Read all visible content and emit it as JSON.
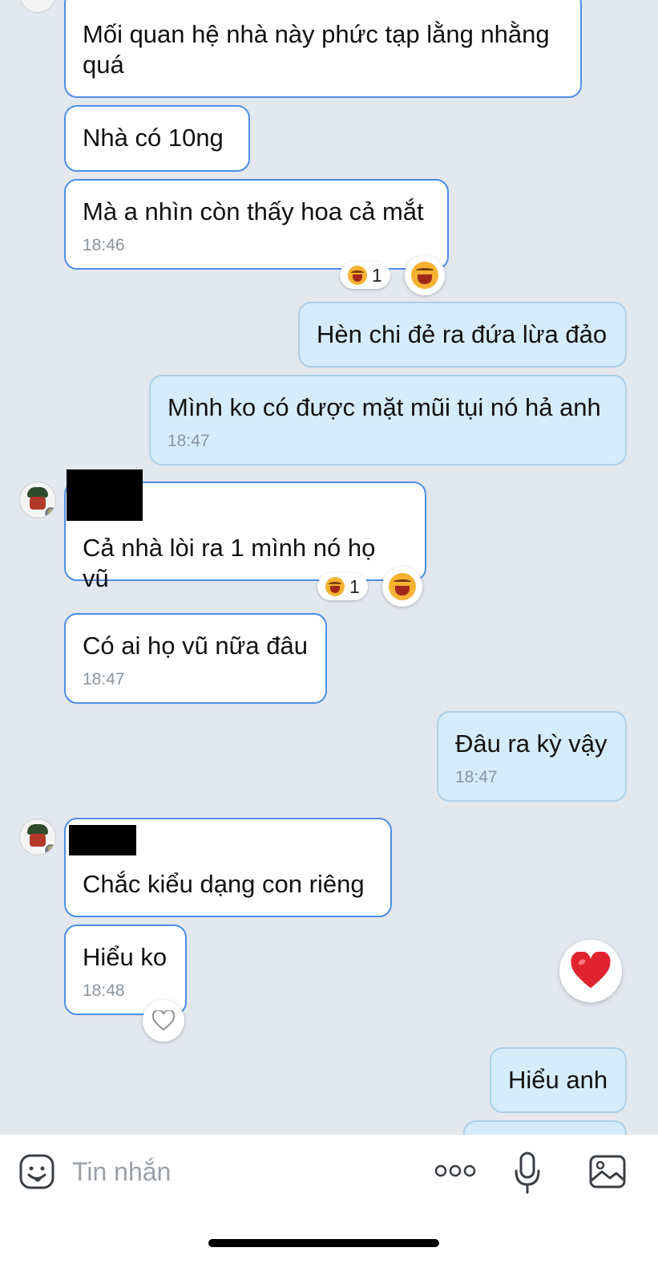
{
  "messages": [
    {
      "text": "Mối quan hệ nhà này phức tạp lằng nhằng quá",
      "time": ""
    },
    {
      "text": "Nhà có 10ng",
      "time": ""
    },
    {
      "text": "Mà a nhìn còn thấy hoa cả mắt",
      "time": "18:46",
      "reaction_count": "1"
    },
    {
      "text": "Hèn chi đẻ ra đứa lừa đảo",
      "time": ""
    },
    {
      "text": "Mình ko có được mặt mũi tụi nó hả anh",
      "time": "18:47"
    },
    {
      "text": "Cả nhà lòi ra 1 mình nó họ vũ",
      "time": "",
      "reaction_count": "1"
    },
    {
      "text": "Có ai họ vũ nữa đâu",
      "time": "18:47"
    },
    {
      "text": "Đâu ra kỳ vậy",
      "time": "18:47"
    },
    {
      "text": "Chắc kiểu dạng con riêng",
      "time": ""
    },
    {
      "text": "Hiểu ko",
      "time": "18:48"
    },
    {
      "text": "Hiểu anh",
      "time": ""
    }
  ],
  "composer": {
    "placeholder": "Tin nhắn"
  },
  "icons": {
    "sticker": "sticker-icon",
    "more": "more-icon",
    "mic": "microphone-icon",
    "image": "image-icon",
    "heart_reaction": "heart-icon",
    "laugh_reaction": "laugh-emoji-icon"
  },
  "colors": {
    "chat_bg": "#e3e7ee",
    "incoming_border": "#4d8ee8",
    "outgoing_bg": "#d6ecfb",
    "heart": "#e0242f"
  }
}
